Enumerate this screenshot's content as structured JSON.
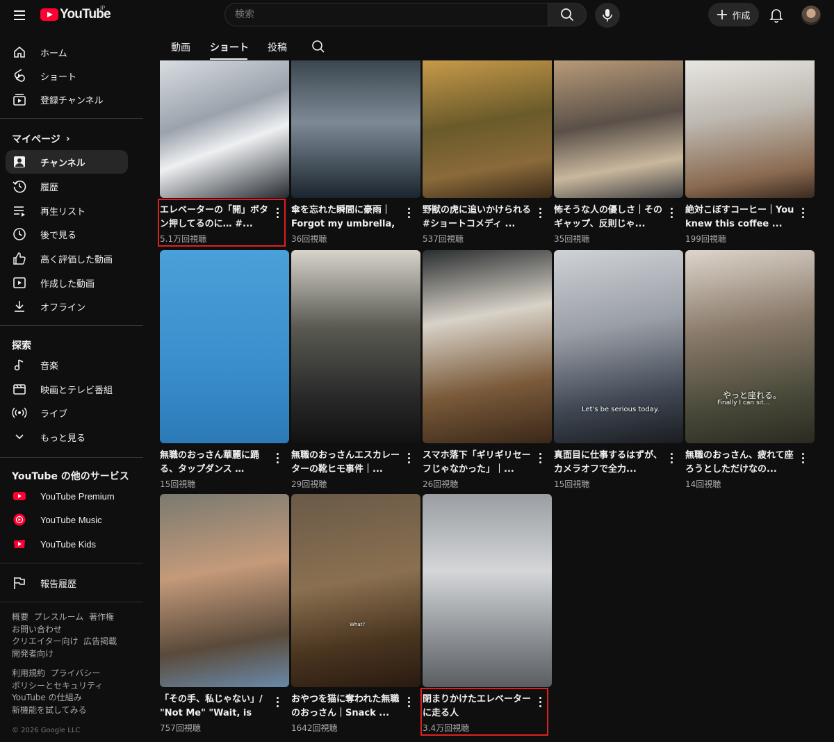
{
  "header": {
    "logo_text": "YouTube",
    "region": "JP",
    "search_placeholder": "検索",
    "create_label": "作成"
  },
  "sidebar": {
    "main": [
      {
        "label": "ホーム",
        "icon": "home-icon"
      },
      {
        "label": "ショート",
        "icon": "shorts-icon"
      },
      {
        "label": "登録チャンネル",
        "icon": "subscriptions-icon"
      }
    ],
    "mypage_title": "マイページ",
    "mypage": [
      {
        "label": "チャンネル",
        "icon": "channel-icon"
      },
      {
        "label": "履歴",
        "icon": "history-icon"
      },
      {
        "label": "再生リスト",
        "icon": "playlist-icon"
      },
      {
        "label": "後で見る",
        "icon": "clock-icon"
      },
      {
        "label": "高く評価した動画",
        "icon": "thumbs-up-icon"
      },
      {
        "label": "作成した動画",
        "icon": "your-videos-icon"
      },
      {
        "label": "オフライン",
        "icon": "download-icon"
      }
    ],
    "explore_title": "探索",
    "explore": [
      {
        "label": "音楽",
        "icon": "music-icon"
      },
      {
        "label": "映画とテレビ番組",
        "icon": "movies-icon"
      },
      {
        "label": "ライブ",
        "icon": "live-icon"
      },
      {
        "label": "もっと見る",
        "icon": "chevron-down-icon"
      }
    ],
    "services_title": "YouTube の他のサービス",
    "services": [
      {
        "label": "YouTube Premium",
        "icon": "youtube-premium-icon"
      },
      {
        "label": "YouTube Music",
        "icon": "youtube-music-icon"
      },
      {
        "label": "YouTube Kids",
        "icon": "youtube-kids-icon"
      }
    ],
    "report": {
      "label": "報告履歴",
      "icon": "flag-icon"
    },
    "footer1": [
      "概要",
      "プレスルーム",
      "著作権",
      "お問い合わせ",
      "クリエイター向け",
      "広告掲載",
      "開発者向け"
    ],
    "footer2": [
      "利用規約",
      "プライバシー",
      "ポリシーとセキュリティ",
      "YouTube の仕組み",
      "新機能を試してみる"
    ],
    "copyright": "© 2026 Google LLC"
  },
  "tabs": [
    "動画",
    "ショート",
    "投稿"
  ],
  "shorts": [
    {
      "title": "エレベーターの「開」ボタン押してるのに… #...",
      "views": "5.1万回視聴",
      "highlight": true
    },
    {
      "title": "傘を忘れた瞬間に豪雨｜Forgot my umbrella, ...",
      "views": "36回視聴"
    },
    {
      "title": "野獣の虎に追いかけられる #ショートコメディ ...",
      "views": "537回視聴"
    },
    {
      "title": "怖そうな人の優しさ｜そのギャップ、反則じゃ...",
      "views": "35回視聴"
    },
    {
      "title": "絶対こぼすコーヒー｜You knew this coffee ...",
      "views": "199回視聴"
    },
    {
      "title": "無職のおっさん華麗に踊る、タップダンス …",
      "views": "15回視聴"
    },
    {
      "title": "無職のおっさんエスカレーターの靴ヒモ事件｜...",
      "views": "29回視聴"
    },
    {
      "title": "スマホ落下「ギリギリセーフじゃなかった」｜...",
      "views": "26回視聴"
    },
    {
      "title": "真面目に仕事するはずが、カメラオフで全力...",
      "views": "15回視聴"
    },
    {
      "title": "無職のおっさん、疲れて座ろうとしただけなの...",
      "views": "14回視聴"
    },
    {
      "title": "「その手、私じゃない」/ \"Not Me\" \"Wait, is that...",
      "views": "757回視聴"
    },
    {
      "title": "おやつを猫に奪われた無職のおっさん｜Snack ...",
      "views": "1642回視聴"
    },
    {
      "title": "閉まりかけたエレベーターに走る人",
      "views": "3.4万回視聴",
      "highlight": true
    }
  ],
  "overlays": {
    "serious": "Let's be serious today.",
    "tired_jp": "やっと座れる。",
    "tired_en": "Finally I can sit…",
    "what": "What?"
  },
  "colors": {
    "background": "#0f0f0f",
    "brand_red": "#ff0033",
    "highlight_border": "#e02020"
  }
}
